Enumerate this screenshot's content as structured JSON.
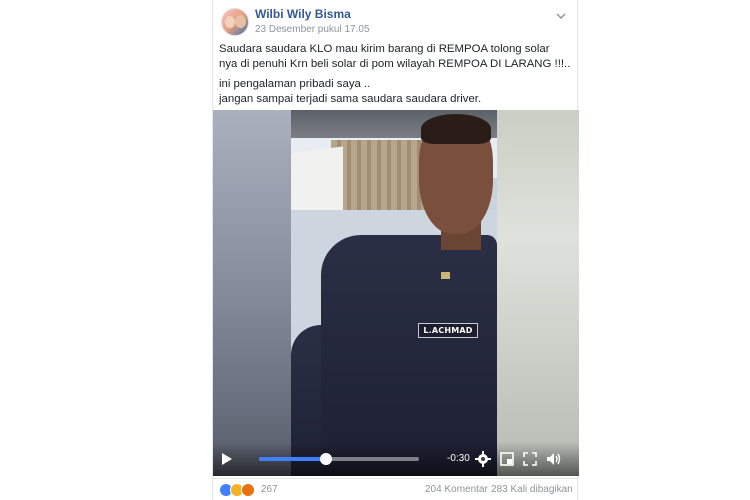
{
  "post": {
    "author": "Wilbi Wily Bisma",
    "timestamp": "23 Desember pukul 17.05",
    "text": [
      "Saudara saudara KLO mau kirim barang di REMPOA tolong solar nya di penuhi Krn beli solar di pom wilayah REMPOA DI LARANG !!!..",
      "ini pengalaman pribadi saya ..\njangan sampai terjadi sama saudara saudara driver."
    ]
  },
  "video": {
    "name_tag": "L.ACHMAD",
    "time_remaining": "-0:30",
    "progress_fraction": 0.42,
    "controls": {
      "play": "play-icon",
      "settings": "gear-icon",
      "pip": "pip-icon",
      "fullscreen": "fullscreen-icon",
      "volume": "volume-icon"
    }
  },
  "footer": {
    "reaction_count": "267",
    "comments": "204 Komentar",
    "shares": "283 Kali dibagikan"
  },
  "colors": {
    "author_link": "#365899",
    "progress": "#4080ff",
    "muted_text": "#90949c"
  }
}
